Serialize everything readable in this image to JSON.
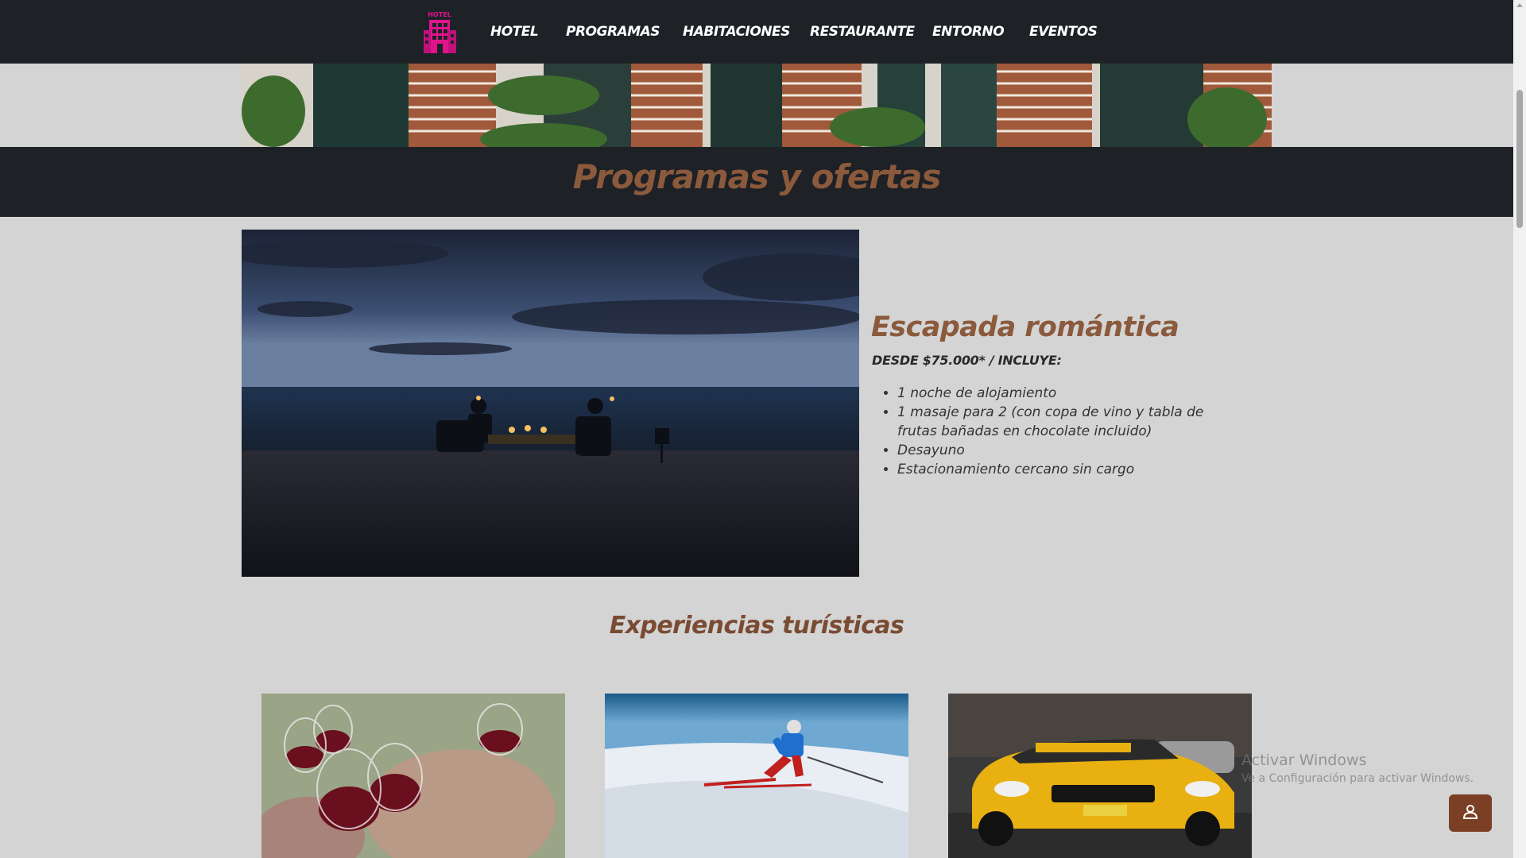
{
  "nav": {
    "logo_text": "HOTEL",
    "items": [
      {
        "label": "HOTEL"
      },
      {
        "label": "PROGRAMAS"
      },
      {
        "label": "HABITACIONES"
      },
      {
        "label": "RESTAURANTE"
      },
      {
        "label": "ENTORNO"
      },
      {
        "label": "EVENTOS"
      }
    ]
  },
  "section": {
    "title": "Programas y ofertas"
  },
  "offer": {
    "title": "Escapada romántica",
    "price": "DESDE $75.000* / INCLUYE:",
    "items": [
      "1 noche de alojamiento",
      "1 masaje para 2 (con copa de vino y tabla de frutas bañadas en chocolate incluido)",
      "Desayuno",
      "Estacionamiento cercano sin cargo"
    ]
  },
  "experiences": {
    "title": "Experiencias turísticas"
  },
  "watermark": {
    "line1": "Activar Windows",
    "line2": "Ve a Configuración para activar Windows."
  },
  "colors": {
    "nav_bg": "#1e2126",
    "accent": "#8b5a3c",
    "page_bg": "#d4d4d4",
    "logo_pink": "#e0148c",
    "user_button": "#7a3f24"
  },
  "icons": {
    "logo": "hotel-building-icon",
    "user": "user-icon"
  }
}
